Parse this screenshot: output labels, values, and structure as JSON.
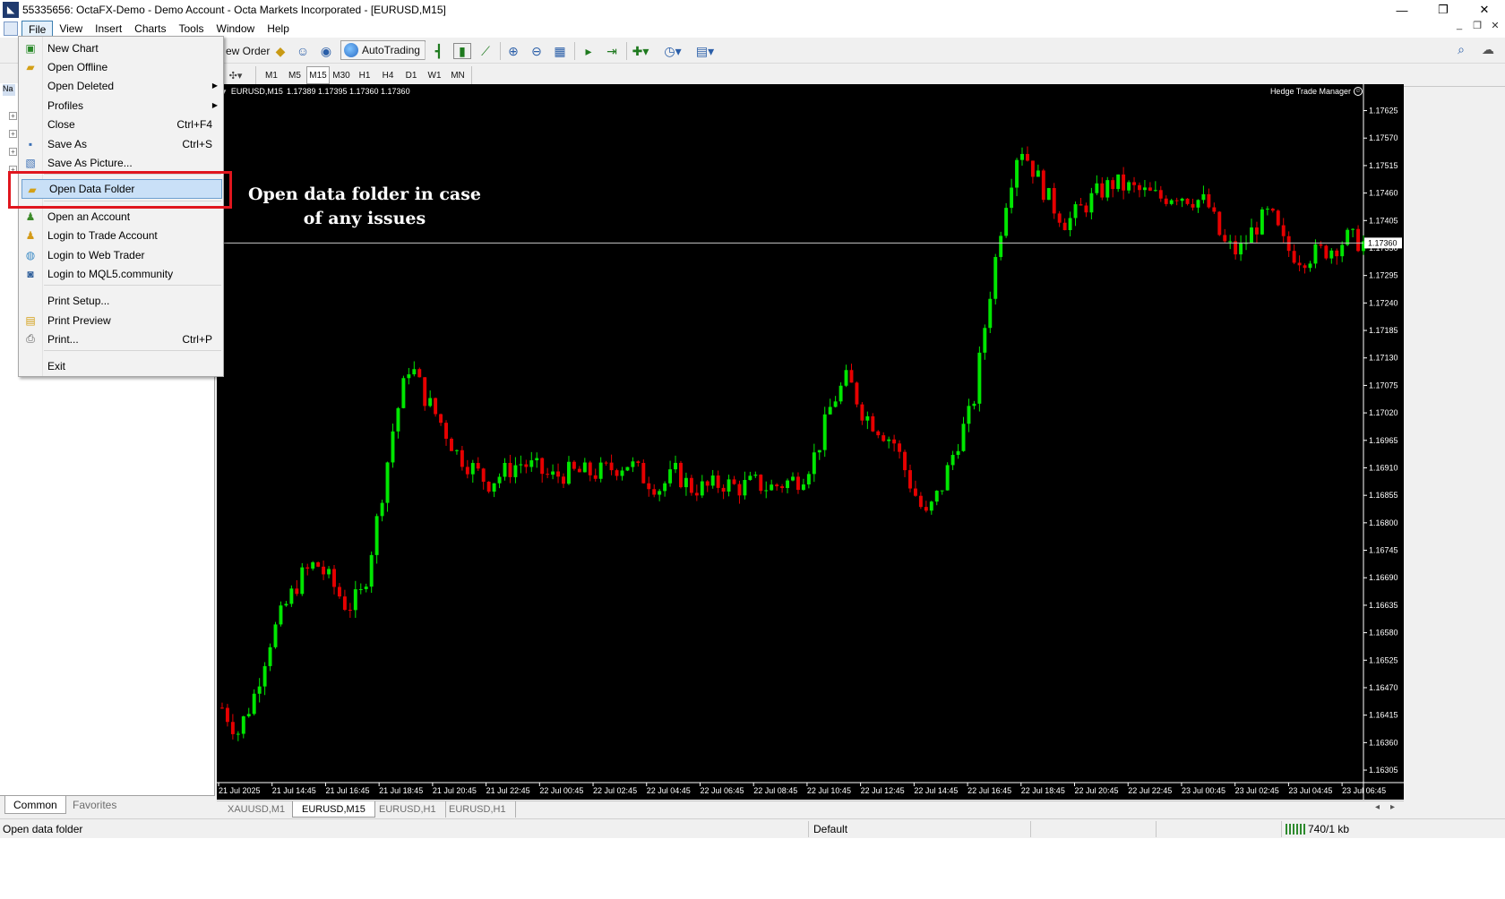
{
  "window": {
    "title": "55335656: OctaFX-Demo - Demo Account - Octa Markets Incorporated - [EURUSD,M15]",
    "app_icon": "metatrader-icon",
    "minimize": "—",
    "restore": "❐",
    "close": "✕"
  },
  "menubar": {
    "items": [
      "File",
      "View",
      "Insert",
      "Charts",
      "Tools",
      "Window",
      "Help"
    ],
    "active": "File",
    "mdi_controls": [
      "_",
      "❐",
      "✕"
    ]
  },
  "toolbar": {
    "new_order_label": "ew Order",
    "autotrading_label": "AutoTrading",
    "timeframes": [
      "M1",
      "M5",
      "M15",
      "M30",
      "H1",
      "H4",
      "D1",
      "W1",
      "MN"
    ],
    "active_timeframe": "M15"
  },
  "file_menu": {
    "items": [
      {
        "label": "New Chart",
        "shortcut": "",
        "icon": "new-chart-icon",
        "submenu": false
      },
      {
        "label": "Open Offline",
        "shortcut": "",
        "icon": "open-offline-icon",
        "submenu": false
      },
      {
        "label": "Open Deleted",
        "shortcut": "",
        "icon": "",
        "submenu": true
      },
      {
        "label": "Profiles",
        "shortcut": "",
        "icon": "",
        "submenu": true
      },
      {
        "label": "Close",
        "shortcut": "Ctrl+F4",
        "icon": "",
        "submenu": false
      },
      {
        "label": "Save As",
        "shortcut": "Ctrl+S",
        "icon": "save-icon",
        "submenu": false
      },
      {
        "label": "Save As Picture...",
        "shortcut": "",
        "icon": "save-picture-icon",
        "submenu": false
      },
      {
        "label": "Open Data Folder",
        "shortcut": "",
        "icon": "folder-icon",
        "submenu": false,
        "highlighted": true
      },
      {
        "label": "Open an Account",
        "shortcut": "",
        "icon": "open-account-icon",
        "submenu": false
      },
      {
        "label": "Login to Trade Account",
        "shortcut": "",
        "icon": "login-icon",
        "submenu": false
      },
      {
        "label": "Login to Web Trader",
        "shortcut": "",
        "icon": "web-trader-icon",
        "submenu": false
      },
      {
        "label": "Login to MQL5.community",
        "shortcut": "",
        "icon": "mql5-icon",
        "submenu": false
      },
      {
        "label": "Print Setup...",
        "shortcut": "",
        "icon": "",
        "submenu": false
      },
      {
        "label": "Print Preview",
        "shortcut": "",
        "icon": "print-preview-icon",
        "submenu": false
      },
      {
        "label": "Print...",
        "shortcut": "Ctrl+P",
        "icon": "print-icon",
        "submenu": false
      },
      {
        "label": "Exit",
        "shortcut": "",
        "icon": "",
        "submenu": false
      }
    ]
  },
  "annotation": {
    "text": "Open data folder in case of any issues",
    "box_color": "#e0161e"
  },
  "navigator": {
    "title": "Na",
    "tabs": [
      "Common",
      "Favorites"
    ],
    "active_tab": "Common"
  },
  "chart": {
    "symbol_info": "EURUSD,M15",
    "ohlc": "1.17389 1.17395 1.17360 1.17360",
    "ea_label": "Hedge Trade Manager",
    "current_price": "1.17360",
    "up_color": "#00e600",
    "down_color": "#e60000",
    "background": "#000000"
  },
  "chart_data": {
    "type": "candlestick",
    "title": "EURUSD,M15",
    "y_ticks": [
      "1.17625",
      "1.17570",
      "1.17515",
      "1.17460",
      "1.17405",
      "1.17350",
      "1.17295",
      "1.17240",
      "1.17185",
      "1.17130",
      "1.17075",
      "1.17020",
      "1.16965",
      "1.16910",
      "1.16855",
      "1.16800",
      "1.16745",
      "1.16690",
      "1.16635",
      "1.16580",
      "1.16525",
      "1.16470",
      "1.16415",
      "1.16360",
      "1.16305"
    ],
    "x_ticks": [
      "21 Jul 2025",
      "21 Jul 14:45",
      "21 Jul 16:45",
      "21 Jul 18:45",
      "21 Jul 20:45",
      "21 Jul 22:45",
      "22 Jul 00:45",
      "22 Jul 02:45",
      "22 Jul 04:45",
      "22 Jul 06:45",
      "22 Jul 08:45",
      "22 Jul 10:45",
      "22 Jul 12:45",
      "22 Jul 14:45",
      "22 Jul 16:45",
      "22 Jul 18:45",
      "22 Jul 20:45",
      "22 Jul 22:45",
      "23 Jul 00:45",
      "23 Jul 02:45",
      "23 Jul 04:45",
      "23 Jul 06:45"
    ],
    "ylim": [
      1.1628,
      1.1766
    ],
    "last_price": 1.1736,
    "close_path": [
      1.1643,
      1.1638,
      1.1645,
      1.1656,
      1.1663,
      1.1669,
      1.1672,
      1.1668,
      1.1663,
      1.1666,
      1.1682,
      1.17,
      1.1712,
      1.1705,
      1.17,
      1.1694,
      1.1691,
      1.1688,
      1.169,
      1.1692,
      1.1691,
      1.1689,
      1.169,
      1.169,
      1.169,
      1.1691,
      1.1692,
      1.1689,
      1.1687,
      1.169,
      1.1687,
      1.1687,
      1.1688,
      1.1687,
      1.1688,
      1.1687,
      1.1688,
      1.1689,
      1.1694,
      1.1704,
      1.1709,
      1.1702,
      1.1699,
      1.1696,
      1.1688,
      1.1681,
      1.1687,
      1.1696,
      1.1703,
      1.1724,
      1.1743,
      1.1756,
      1.175,
      1.1744,
      1.174,
      1.1743,
      1.1746,
      1.1748,
      1.1747,
      1.1746,
      1.1745,
      1.1746,
      1.1745,
      1.1744,
      1.1736,
      1.1734,
      1.1739,
      1.1742,
      1.1735,
      1.1733,
      1.1734,
      1.1735,
      1.1737,
      1.1736
    ]
  },
  "chart_tabs": {
    "items": [
      "XAUUSD,M1",
      "EURUSD,M15",
      "EURUSD,H1",
      "EURUSD,H1"
    ],
    "active": "EURUSD,M15"
  },
  "statusbar": {
    "message": "Open data folder",
    "profile": "Default",
    "traffic": "740/1 kb"
  }
}
